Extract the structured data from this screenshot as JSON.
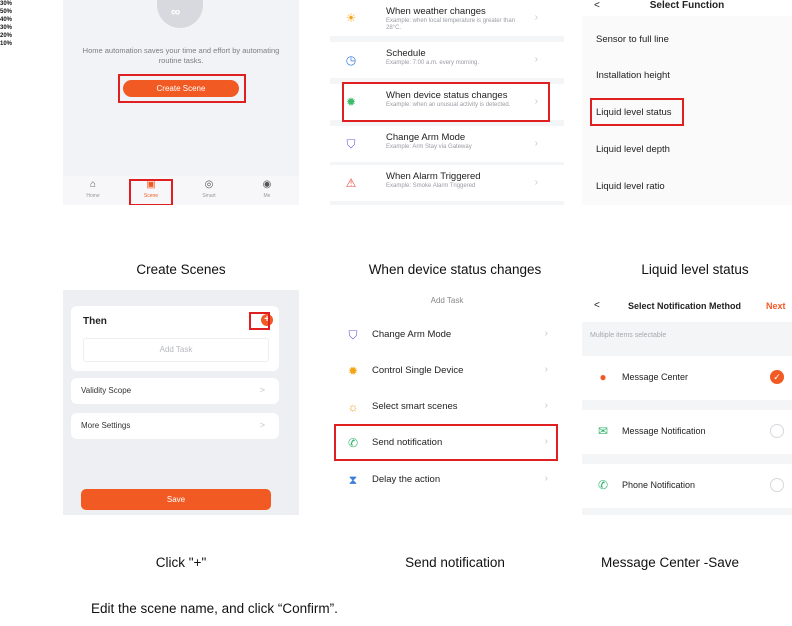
{
  "scale_labels": [
    "30%",
    "50%",
    "40%",
    "30%",
    "20%",
    "10%"
  ],
  "panel1": {
    "logo_glyph": "∞",
    "intro_text": "Home automation saves your time and effort by automating routine tasks.",
    "create_button": "Create Scene",
    "tabs": [
      {
        "label": "Home",
        "icon": "⌂"
      },
      {
        "label": "Scene",
        "icon": "▣"
      },
      {
        "label": "Smart",
        "icon": "◎"
      },
      {
        "label": "Me",
        "icon": "◉"
      }
    ]
  },
  "panel2": {
    "items": [
      {
        "title": "When weather changes",
        "subtitle": "Example: when local temperature is greater than 28°C.",
        "icon": "☀",
        "icon_color": "#f2a516"
      },
      {
        "title": "Schedule",
        "subtitle": "Example: 7:00 a.m. every morning.",
        "icon": "◷",
        "icon_color": "#3b7ddd"
      },
      {
        "title": "When device status changes",
        "subtitle": "Example: when an unusual activity is detected.",
        "icon": "✹",
        "icon_color": "#3dbd6a"
      },
      {
        "title": "Change Arm Mode",
        "subtitle": "Example: Arm Stay via Gateway",
        "icon": "⛉",
        "icon_color": "#6b5bd8"
      },
      {
        "title": "When Alarm Triggered",
        "subtitle": "Example: Smoke Alarm Triggered",
        "icon": "⚠",
        "icon_color": "#e8453c"
      }
    ]
  },
  "panel3": {
    "back": "<",
    "title": "Select Function",
    "items": [
      "Sensor to full line",
      "Installation height",
      "Liquid level status",
      "Liquid level depth",
      "Liquid level ratio"
    ]
  },
  "captions": {
    "c1": "Create Scenes",
    "c2": "When device status changes",
    "c3": "Liquid level status",
    "c4": "Click \"+\"",
    "c5": "Send notification",
    "c6": "Message Center -Save"
  },
  "panel4": {
    "then_title": "Then",
    "plus": "+",
    "add_task": "Add Task",
    "validity": "Validity Scope",
    "more": "More Settings",
    "chevron": ">",
    "save": "Save"
  },
  "panel5": {
    "title": "Add Task",
    "items": [
      {
        "label": "Change Arm Mode",
        "icon": "⛉",
        "icon_color": "#6b5bd8"
      },
      {
        "label": "Control Single Device",
        "icon": "✹",
        "icon_color": "#f2a516"
      },
      {
        "label": "Select smart scenes",
        "icon": "☼",
        "icon_color": "#f0a020"
      },
      {
        "label": "Send notification",
        "icon": "✆",
        "icon_color": "#2fb36b"
      },
      {
        "label": "Delay the action",
        "icon": "⧗",
        "icon_color": "#3b7ddd"
      }
    ]
  },
  "panel6": {
    "back": "<",
    "title": "Select Notification Method",
    "next": "Next",
    "multi": "Multiple items selectable",
    "items": [
      {
        "label": "Message Center",
        "icon": "●",
        "icon_color": "#f25a23",
        "checked": true
      },
      {
        "label": "Message Notification",
        "icon": "✉",
        "icon_color": "#2fb36b",
        "checked": false
      },
      {
        "label": "Phone Notification",
        "icon": "✆",
        "icon_color": "#2fb36b",
        "checked": false
      }
    ],
    "check_glyph": "✓"
  },
  "footer": "Edit the scene name, and click “Confirm”.",
  "colors": {
    "accent": "#f25a23",
    "highlight": "#e02020"
  }
}
